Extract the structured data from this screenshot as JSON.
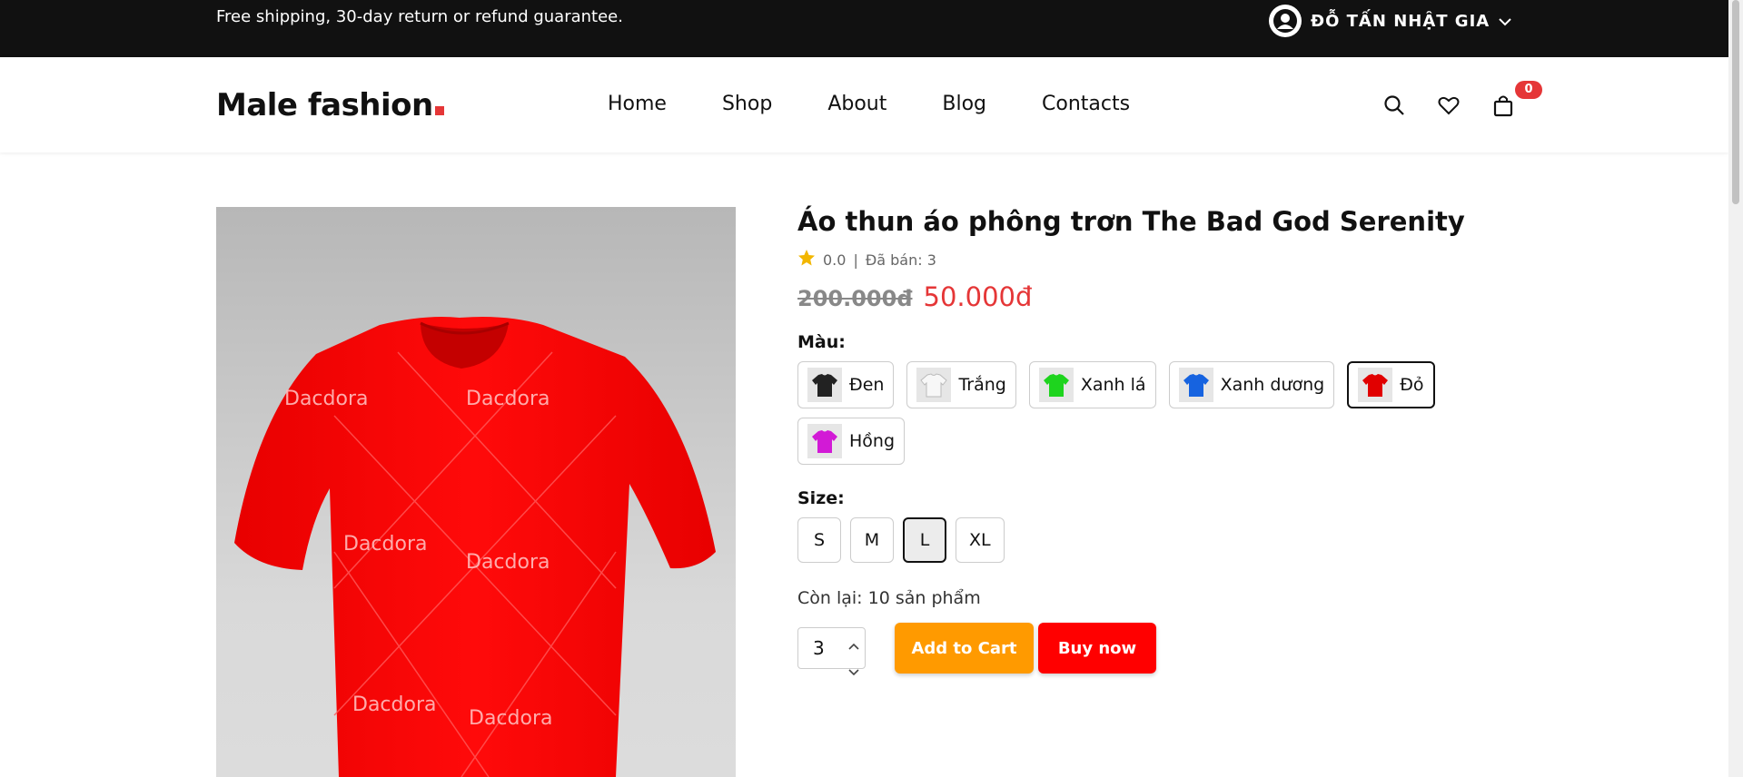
{
  "topbar": {
    "shipping_text": "Free shipping, 30-day return or refund guarantee.",
    "user_name": "ĐỖ TẤN NHẬT GIA"
  },
  "header": {
    "logo_text": "Male fashion",
    "nav": [
      "Home",
      "Shop",
      "About",
      "Blog",
      "Contacts"
    ],
    "cart_count": "0"
  },
  "product": {
    "title": "Áo thun áo phông trơn The Bad God Serenity",
    "rating": "0.0",
    "separator": "|",
    "sold": "Đã bán: 3",
    "old_price": "200.000đ",
    "new_price": "50.000đ",
    "color_label": "Màu:",
    "colors": [
      {
        "name": "Đen",
        "shirt": "#222222",
        "selected": false
      },
      {
        "name": "Trắng",
        "shirt": "#f2f2f2",
        "selected": false
      },
      {
        "name": "Xanh lá",
        "shirt": "#1ed41e",
        "selected": false
      },
      {
        "name": "Xanh dương",
        "shirt": "#1663e0",
        "selected": false
      },
      {
        "name": "Đỏ",
        "shirt": "#e10000",
        "selected": true
      },
      {
        "name": "Hồng",
        "shirt": "#d21ad6",
        "selected": false
      }
    ],
    "size_label": "Size:",
    "sizes": [
      "S",
      "M",
      "L",
      "XL"
    ],
    "selected_size": "L",
    "stock": "Còn lại: 10 sản phẩm",
    "quantity": "3",
    "add_to_cart": "Add to Cart",
    "buy_now": "Buy now",
    "image_brand": "Dacdora",
    "image_color": "#ff0a0a"
  }
}
